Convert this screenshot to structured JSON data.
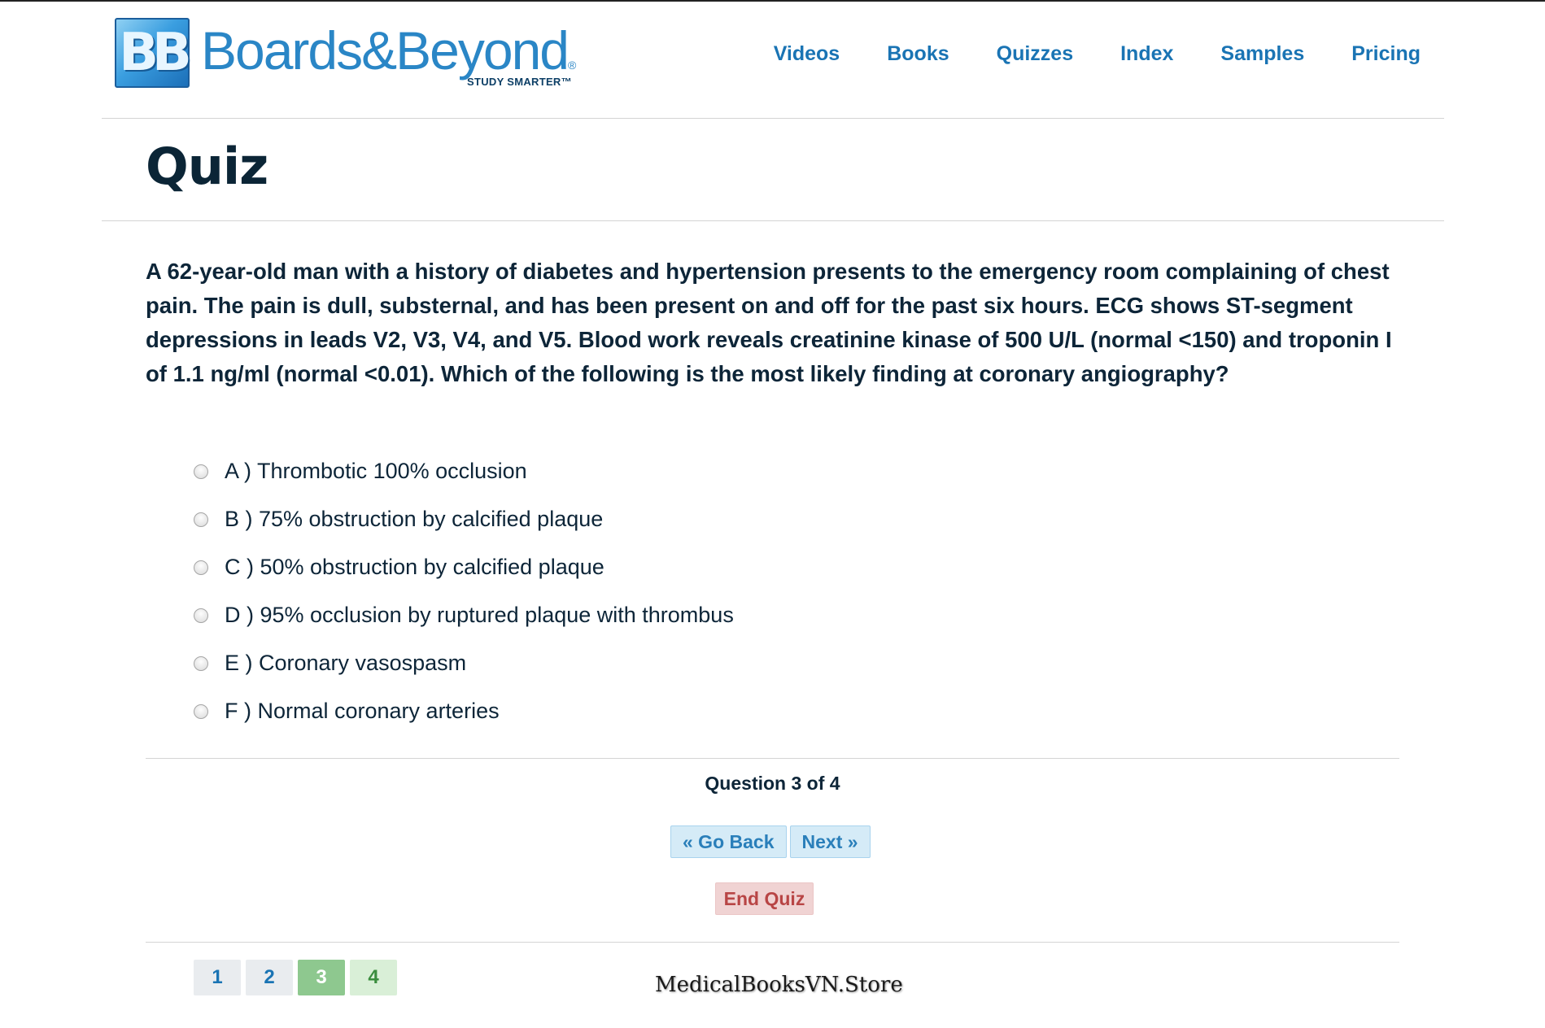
{
  "brand": {
    "logo_mark": "BB",
    "name": "Boards&Beyond",
    "registered": "®",
    "tagline": "STUDY SMARTER™"
  },
  "nav": {
    "items": [
      {
        "label": "Videos"
      },
      {
        "label": "Books"
      },
      {
        "label": "Quizzes"
      },
      {
        "label": "Index"
      },
      {
        "label": "Samples"
      },
      {
        "label": "Pricing"
      }
    ]
  },
  "page": {
    "title": "Quiz"
  },
  "quiz": {
    "question": "A 62-year-old man with a history of diabetes and hypertension presents to the emergency room complaining of chest pain. The pain is dull, substernal, and has been present on and off for the past six hours. ECG shows ST-segment depressions in leads V2, V3, V4, and V5. Blood work reveals creatinine kinase of 500 U/L (normal <150) and troponin I of 1.1 ng/ml (normal <0.01). Which of the following is the most likely finding at coronary angiography?",
    "options": [
      {
        "label": "A ) Thrombotic 100% occlusion"
      },
      {
        "label": "B ) 75% obstruction by calcified plaque"
      },
      {
        "label": "C ) 50% obstruction by calcified plaque"
      },
      {
        "label": "D ) 95% occlusion by ruptured plaque with thrombus"
      },
      {
        "label": "E ) Coronary vasospasm"
      },
      {
        "label": "F ) Normal coronary arteries"
      }
    ],
    "counter": "Question 3 of 4",
    "back_label": "« Go Back",
    "next_label": "Next »",
    "end_label": "End Quiz",
    "pages": [
      {
        "label": "1",
        "state": "unvisited"
      },
      {
        "label": "2",
        "state": "unvisited"
      },
      {
        "label": "3",
        "state": "current"
      },
      {
        "label": "4",
        "state": "upcoming"
      }
    ]
  },
  "watermark": "MedicalBooksVN.Store",
  "colors": {
    "brand_blue": "#1a74b4",
    "text_dark": "#0d2538",
    "nav_button_bg": "#d5ebf7",
    "end_button_bg": "#f0d3d3",
    "end_button_text": "#b84545",
    "page_current": "#8ec88f",
    "page_upcoming": "#d9efd7"
  }
}
